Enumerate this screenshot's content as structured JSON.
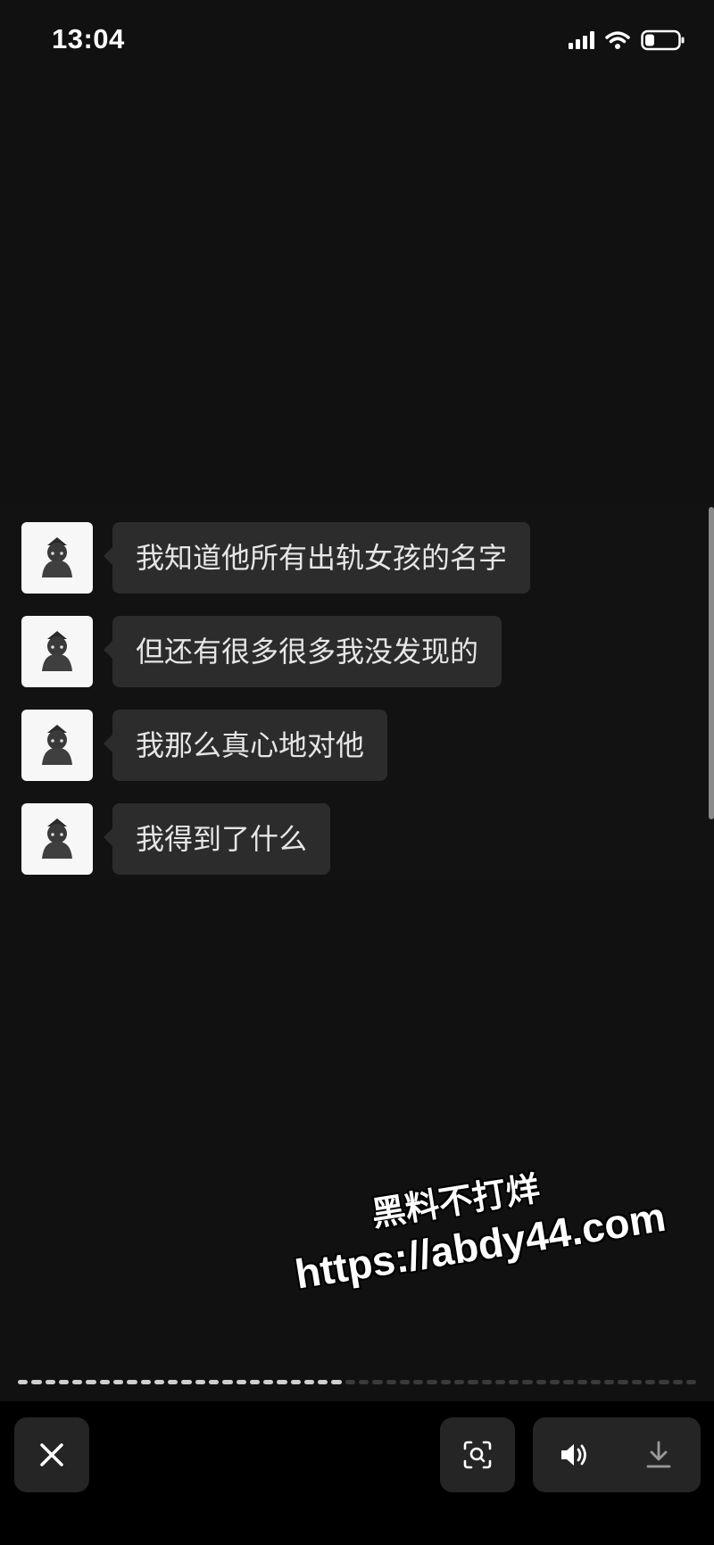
{
  "status_bar": {
    "time": "13:04"
  },
  "messages": [
    {
      "text": "我知道他所有出轨女孩的名字"
    },
    {
      "text": "但还有很多很多我没发现的"
    },
    {
      "text": "我那么真心地对他"
    },
    {
      "text": "我得到了什么"
    }
  ],
  "watermark": {
    "line1": "黑料不打烊",
    "line2": "https://abdy44.com"
  },
  "progress": {
    "segments_total": 50,
    "segments_done": 24
  },
  "toolbar": {
    "close_icon": "close-icon",
    "scan_icon": "scan-search-icon",
    "volume_icon": "volume-icon",
    "download_icon": "download-icon"
  }
}
